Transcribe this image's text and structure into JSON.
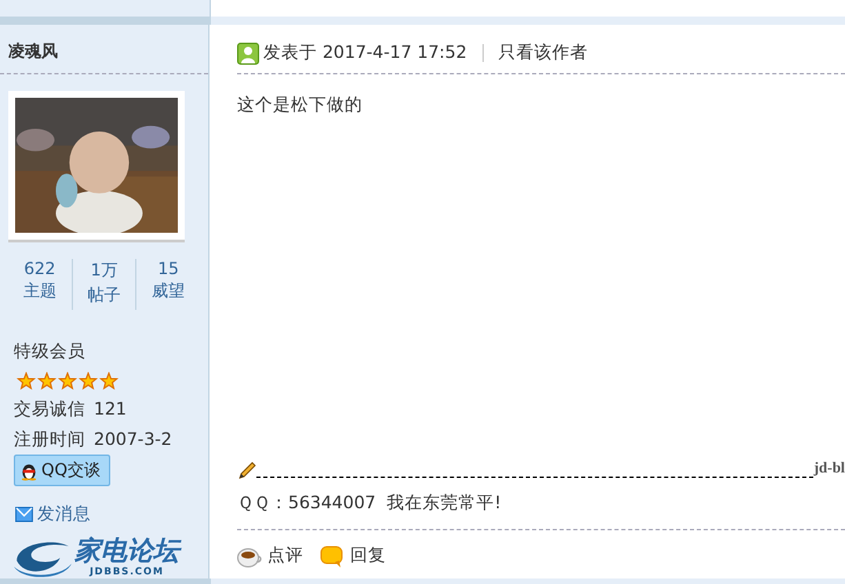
{
  "author": {
    "name": "凌魂风",
    "stats": [
      {
        "value": "622",
        "label": "主题"
      },
      {
        "value": "1万",
        "label": "帖子"
      },
      {
        "value": "15",
        "label": "威望"
      }
    ],
    "group": "特级会员",
    "stars": 5,
    "fields": [
      {
        "label": "交易诚信",
        "value": "121"
      },
      {
        "label": "注册时间",
        "value": "2007-3-2"
      }
    ],
    "qq_button": "QQ交谈",
    "message_link": "发消息"
  },
  "logo": {
    "name": "家电论坛",
    "domain": "JDBBS.COM"
  },
  "post": {
    "posted": "发表于 2017-4-17 17:52",
    "author_only": "只看该作者",
    "body": "这个是松下做的",
    "signature_tag": "jd-bl",
    "signature": "ＱＱ：56344007  我在东莞常平!",
    "actions": [
      {
        "kind": "comment",
        "label": "点评"
      },
      {
        "kind": "reply",
        "label": "回复"
      }
    ]
  }
}
